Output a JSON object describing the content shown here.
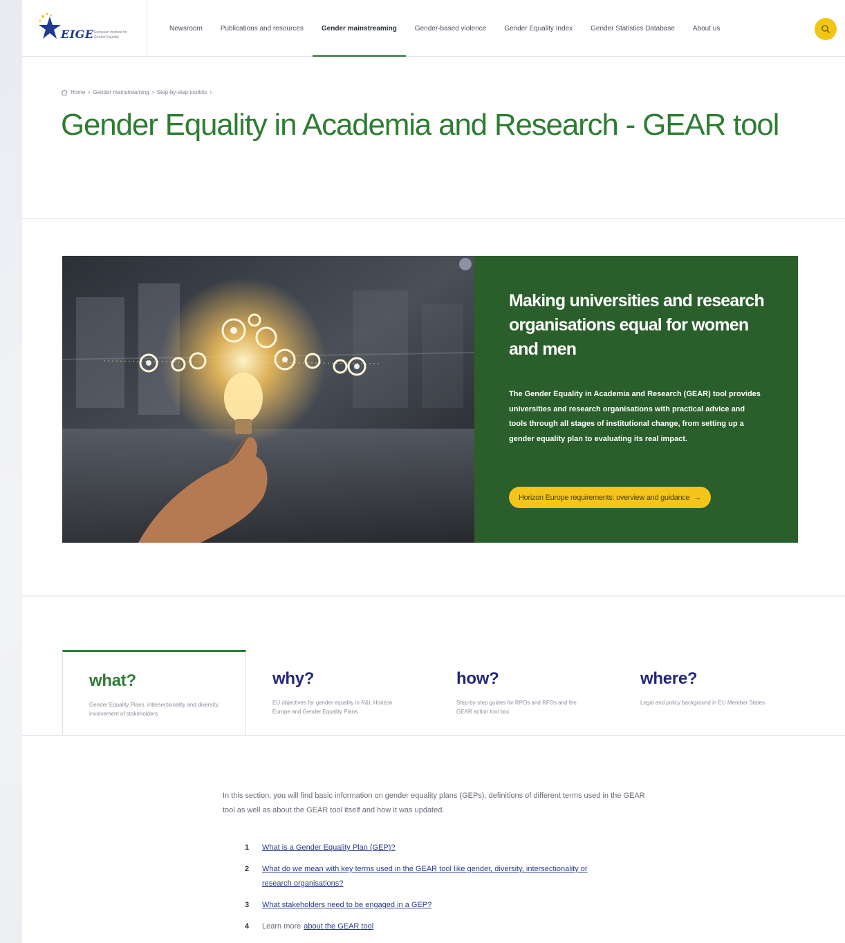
{
  "header": {
    "logo_text": "EIGE",
    "logo_tagline": "European Institute for Gender Equality",
    "nav": [
      {
        "label": "Newsroom",
        "active": false
      },
      {
        "label": "Publications and resources",
        "active": false
      },
      {
        "label": "Gender mainstreaming",
        "active": true
      },
      {
        "label": "Gender-based violence",
        "active": false
      },
      {
        "label": "Gender Equality Index",
        "active": false
      },
      {
        "label": "Gender Statistics Database",
        "active": false
      },
      {
        "label": "About us",
        "active": false
      }
    ],
    "search_icon": "search-icon"
  },
  "breadcrumb": {
    "items": [
      "Home",
      "Gender mainstreaming",
      "Step-by-step toolkits"
    ]
  },
  "page_title": "Gender Equality in Academia and Research - GEAR tool",
  "hero": {
    "heading": "Making universities and research organisations equal for women and men",
    "text": "The Gender Equality in Academia and Research (GEAR) tool provides universities and research organisations with practical advice and tools through all stages of institutional change, from setting up a gender equality plan to evaluating its real impact.",
    "cta_label": "Horizon Europe requirements: overview and guidance",
    "cta_arrow": "→",
    "panel_color": "#2a5e2b",
    "cta_color": "#f5c51a"
  },
  "tabs": [
    {
      "title": "what?",
      "desc": "Gender Equality Plans, intersectionality and diversity, involvement of stakeholders",
      "active": true
    },
    {
      "title": "why?",
      "desc": "EU objectives for gender equality in R&I, Horizon Europe and Gender Equality Plans",
      "active": false
    },
    {
      "title": "how?",
      "desc": "Step-by-step guides for RPOs and RFOs and the GEAR action tool box",
      "active": false
    },
    {
      "title": "where?",
      "desc": "Legal and policy background in EU Member States",
      "active": false
    }
  ],
  "intro": "In this section, you will find basic information on gender equality plans (GEPs), definitions of different terms used in the GEAR tool as well as about the GEAR tool itself and how it was updated.",
  "questions": [
    {
      "num": "1",
      "prefix": "",
      "link": "What is a Gender Equality Plan (GEP)?"
    },
    {
      "num": "2",
      "prefix": "",
      "link": "What do we mean with key terms used in the GEAR tool like gender, diversity, intersectionality or research organisations?"
    },
    {
      "num": "3",
      "prefix": "",
      "link": "What stakeholders need to be engaged in a GEP?"
    },
    {
      "num": "4",
      "prefix": "Learn more",
      "link": "about the GEAR tool"
    }
  ],
  "colors": {
    "title_green": "#2e7d32",
    "tab_blue": "#22287a",
    "search_yellow": "#f2c514"
  }
}
